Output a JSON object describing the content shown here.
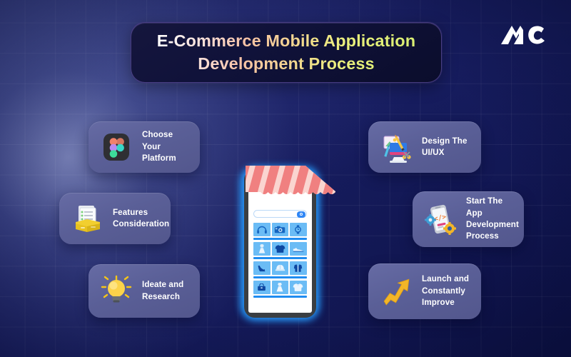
{
  "header": {
    "title": "E-Commerce Mobile Application\nDevelopment Process",
    "logo_text": "MC",
    "logo_name": "mc-brand-logo"
  },
  "theme": {
    "background_navy": "#151b60",
    "background_navy_dark": "#101552",
    "grid_line": "#ffffff0e",
    "title_box_bg": "#0d0f33",
    "title_box_border": "#7460be",
    "card_bg": "#5a5f97",
    "card_text": "#ffffff",
    "title_gradient_start": "#ffffff",
    "title_gradient_mid": "#f7c2a6",
    "title_gradient_end": "#d8ef72",
    "phone_glow_blue": "#27a0ff",
    "phone_frame": "#3a3e42",
    "awning_pink": "#f08080",
    "awning_light_pink": "#fad5d0",
    "tile_blue": "#6bbcf5",
    "divider_blue": "#1f8cf0",
    "accent_yellow": "#f5c518"
  },
  "steps": [
    {
      "id": "choose-your-platform",
      "label": "Choose Your\nPlatform",
      "icon": "figma-logo-icon",
      "side": "left"
    },
    {
      "id": "features-consideration",
      "label": "Features\nConsideration",
      "icon": "documents-box-icon",
      "side": "left"
    },
    {
      "id": "ideate-and-research",
      "label": "Ideate and\nResearch",
      "icon": "lightbulb-icon",
      "side": "left"
    },
    {
      "id": "design-the-ui-ux",
      "label": "Design The\nUI/UX",
      "icon": "design-monitor-icon",
      "side": "right"
    },
    {
      "id": "start-the-app-development",
      "label": "Start The App\nDevelopment\nProcess",
      "icon": "phone-code-gear-icon",
      "side": "right"
    },
    {
      "id": "launch-and-improve",
      "label": "Launch and\nConstantly\nImprove",
      "icon": "growth-arrow-icon",
      "side": "right"
    }
  ],
  "phone_mockup": {
    "name": "ecommerce-app-mockup",
    "awning": "shop-awning-stripes",
    "search_placeholder": "",
    "search_button_icon": "search-icon",
    "product_rows": [
      {
        "items": [
          "headphones-icon",
          "camera-icon",
          "watch-icon"
        ]
      },
      {
        "items": [
          "dress-icon",
          "tshirt-icon",
          "shoe-icon"
        ]
      },
      {
        "items": [
          "high-heel-icon",
          "cap-icon",
          "jacket-icon"
        ]
      },
      {
        "items": [
          "handbag-icon",
          "gown-icon",
          "polo-shirt-icon"
        ]
      }
    ]
  }
}
